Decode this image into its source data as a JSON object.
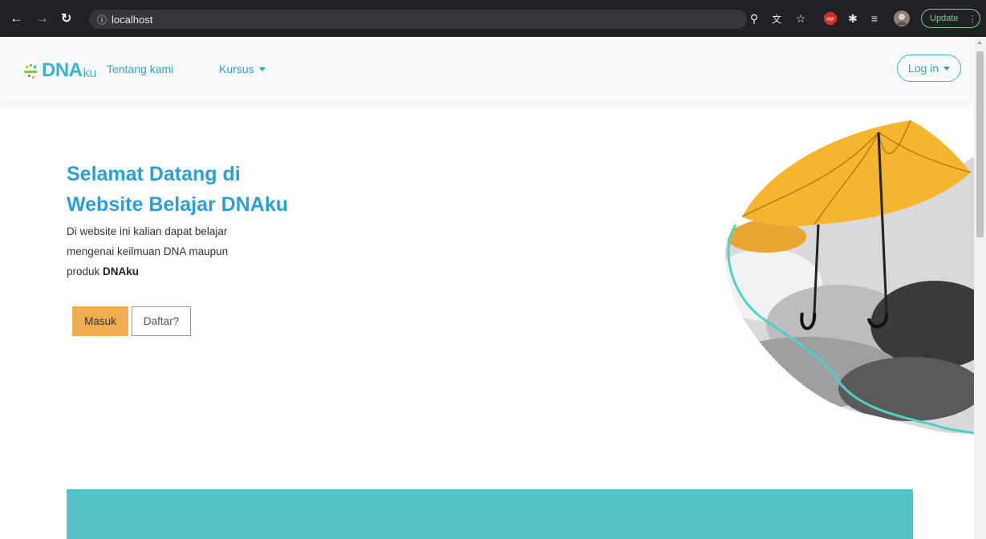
{
  "browser": {
    "url": "localhost",
    "update_label": "Update",
    "icons": [
      "back-icon",
      "forward-icon",
      "reload-icon",
      "info-icon",
      "key-icon",
      "translate-icon",
      "star-icon",
      "adblock-icon",
      "puzzle-icon",
      "reading-list-icon",
      "profile-avatar",
      "kebab-menu-icon"
    ]
  },
  "navbar": {
    "logo_main": "DNA",
    "logo_suffix": "ku",
    "link_about": "Tentang kami",
    "link_courses": "Kursus",
    "login_label": "Log in"
  },
  "hero": {
    "title_line1": "Selamat Datang di",
    "title_line2": "Website Belajar DNAku",
    "desc_line1": "Di website ini kalian dapat belajar",
    "desc_line2": "mengenai keilmuan DNA maupun",
    "desc_line3_prefix": "produk ",
    "desc_line3_bold": "DNAku",
    "btn_masuk": "Masuk",
    "btn_daftar": "Daftar?"
  },
  "colors": {
    "accent": "#38b6c5",
    "title": "#2a9fd8",
    "button_primary": "#f0ad4e",
    "band": "#53c3c4"
  }
}
